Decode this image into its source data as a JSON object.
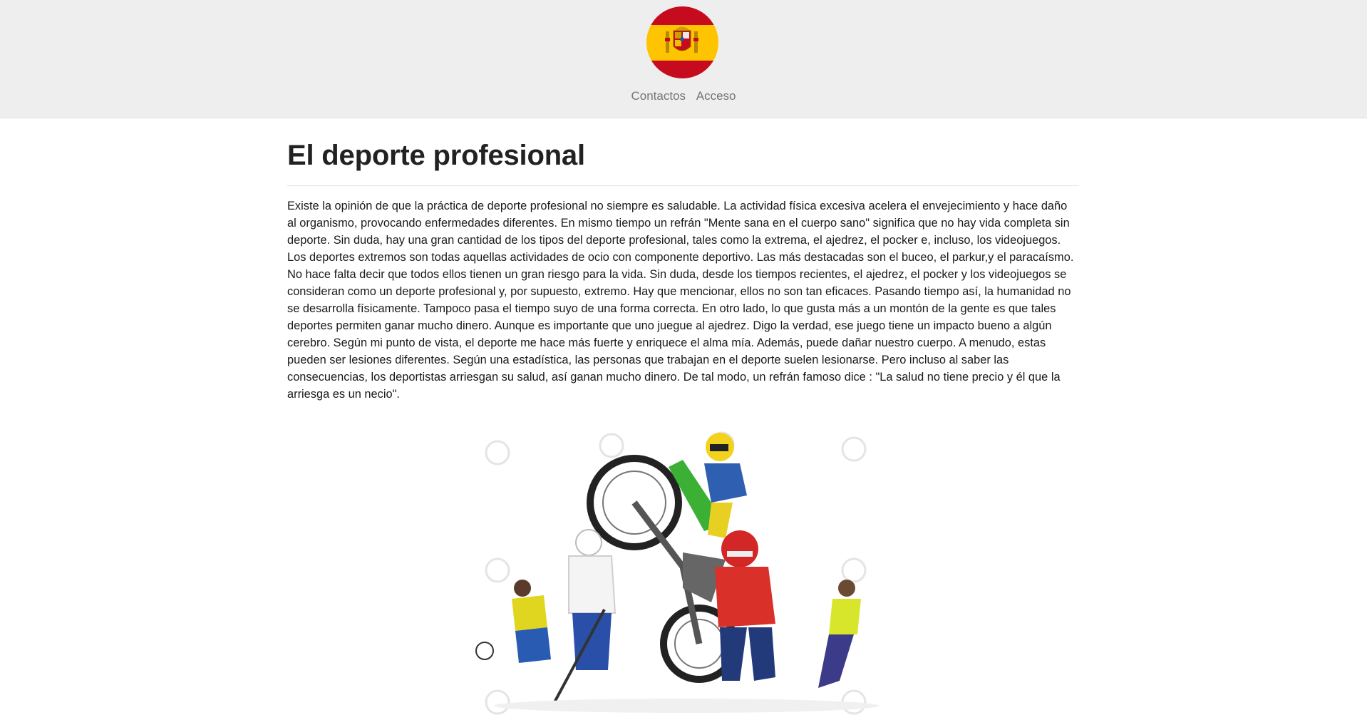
{
  "header": {
    "logo_icon": "spain-flag-emblem-icon",
    "colors": {
      "background": "#eeeeee",
      "flag_red": "#c60b1e",
      "flag_yellow": "#ffc400"
    },
    "nav": [
      {
        "label": "Contactos"
      },
      {
        "label": "Acceso"
      }
    ]
  },
  "article": {
    "title": "El deporte profesional",
    "body": "Existe la opinión de que la práctica de deporte profesional no siempre es saludable. La actividad física excesiva acelera el envejecimiento y hace daño al organismo, provocando enfermedades diferentes. En mismo tiempo un refrán \"Mente sana en el cuerpo sano\" significa que no hay vida completa sin deporte. Sin duda, hay una gran cantidad de los tipos del deporte profesional, tales como la extrema, el ajedrez, el pocker e, incluso, los videojuegos. Los deportes extremos son todas aquellas actividades de ocio con componente deportivo. Las más destacadas son el buceo, el parkur,y el paracaísmo. No hace falta decir que todos ellos tienen un gran riesgo para la vida. Sin duda, desde los tiempos recientes, el ajedrez, el pocker y los videojuegos se consideran como un deporte profesional y, por supuesto, extremo. Hay que mencionar, ellos no son tan eficaces. Pasando tiempo así, la humanidad no se desarrolla físicamente. Tampoco pasa el tiempo suyo de una forma correcta. En otro lado, lo que gusta más a un montón de la gente es que tales deportes permiten ganar mucho dinero. Aunque es importante que uno juegue al ajedrez. Digo la verdad, ese juego tiene un impacto bueno a algún cerebro. Según mi punto de vista, el deporte me hace más fuerte y enriquece el alma mía. Además, puede dañar nuestro cuerpo. A menudo, estas pueden ser lesiones diferentes. Según una estadística, las personas que trabajan en el deporte suelen lesionarse. Pero incluso al saber las consecuencias, los deportistas arriesgan su salud, así ganan mucho dinero. De tal modo, un refrán famoso dice : \"La salud no tiene precio y él que la arriesga es un necio\".",
    "image_icon": "sports-collage-image"
  }
}
